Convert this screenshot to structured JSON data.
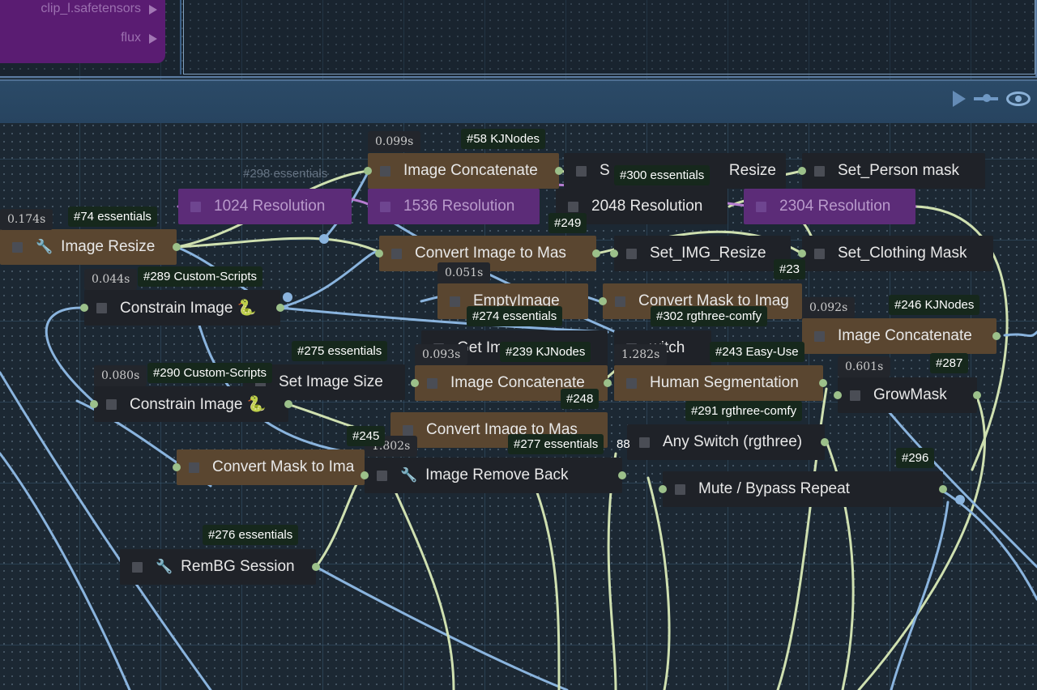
{
  "top_panel": {
    "row1": "clip_l.safetensors",
    "row2": "flux"
  },
  "colors": {
    "brown_node": "#5a4630",
    "dark_node": "#1f2228",
    "purple_node": "#5c2c78",
    "badge": "#16281c",
    "wire_green": "#cfe0b0",
    "wire_blue": "#8ab4de"
  },
  "group_bar": {
    "icons": [
      "play-icon",
      "link-icon",
      "eye-icon"
    ]
  },
  "nodes": {
    "image_concatenate_top": "Image Concatenate",
    "set_resize": "S",
    "set_resize_right": "Resize",
    "set_person_mask": "Set_Person mask",
    "res_1024": "1024 Resolution",
    "res_1536": "1536 Resolution",
    "res_2048": "2048 Resolution",
    "res_2304": "2304 Resolution",
    "image_resize": "Image Resize",
    "convert_image_to_mask_1": "Convert Image to Mas",
    "set_img_resize": "Set_IMG_Resize",
    "set_clothing_mask": "Set_Clothing Mask",
    "constrain_image_1": "Constrain Image 🐍",
    "empty_image": "EmptyImage",
    "convert_mask_to_image_1": "Convert Mask to Imag",
    "image_concatenate_right": "Image Concatenate",
    "set_image_size": "Set Image Size",
    "get_im": "Get Im",
    "switch_partial": "witch",
    "image_concatenate_mid": "Image Concatenate",
    "human_segmentation": "Human Segmentation",
    "grow_mask": "GrowMask",
    "constrain_image_2": "Constrain Image 🐍",
    "convert_image_to_mask_2": "Convert Image to Mas",
    "any_switch": "Any Switch (rgthree)",
    "convert_mask_to_image_2": "Convert Mask to Ima",
    "image_remove_back": "Image Remove Back",
    "mute_bypass": "Mute / Bypass Repeat",
    "rembg_session": "RemBG Session"
  },
  "badges": {
    "b58": "#58 KJNodes",
    "b300": "#300 essentials",
    "b74": "#74 essentials",
    "b249": "#249",
    "b289": "#289 Custom-Scripts",
    "b23x": "#23",
    "b274": "#274 essentials",
    "b302": "#302 rgthree-comfy",
    "b246": "#246 KJNodes",
    "b275": "#275 essentials",
    "b239": "#239 KJNodes",
    "b243": "#243 Easy-Use",
    "b287": "#287",
    "b290": "#290 Custom-Scripts",
    "b248": "#248",
    "b291": "#291 rgthree-comfy",
    "b245": "#245",
    "b277": "#277 essentials",
    "b288": "88",
    "b296": "#296",
    "b276": "#276 essentials"
  },
  "ghost_labels": {
    "g298": "#298 essentials"
  },
  "times": {
    "t_concat_top": "0.099s",
    "t_image_resize": "0.174s",
    "t_constrain_1": "0.044s",
    "t_empty": "0.051s",
    "t_concat_right": "0.092s",
    "t_concat_mid": "0.093s",
    "t_human_seg": "1.282s",
    "t_grow_mask": "0.601s",
    "t_constrain_2": "0.080s",
    "t_remove_back": "1.802s"
  }
}
